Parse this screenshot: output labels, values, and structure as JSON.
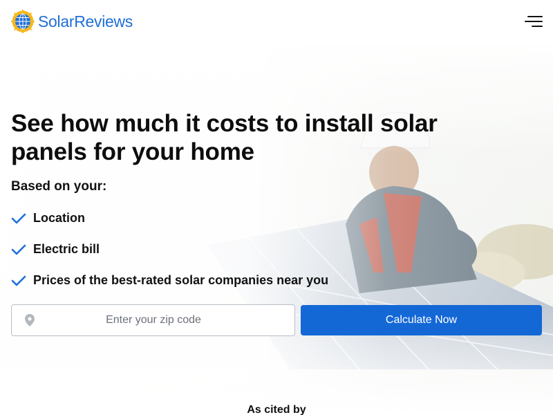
{
  "header": {
    "brand": "SolarReviews",
    "logo_icon": "sun-globe-logo-icon",
    "menu_icon": "hamburger-menu-icon"
  },
  "hero": {
    "headline": "See how much it costs to install solar panels for your home",
    "based_on": "Based on your:",
    "check_icon": "checkmark-icon",
    "items": [
      {
        "label": "Location"
      },
      {
        "label": "Electric bill"
      },
      {
        "label": "Prices of the best-rated solar companies near you"
      }
    ],
    "background": "solar-installer-photo"
  },
  "form": {
    "zip_placeholder": "Enter your zip code",
    "zip_value": "",
    "pin_icon": "location-pin-icon",
    "submit_label": "Calculate Now"
  },
  "footer": {
    "cited_by": "As cited by"
  },
  "colors": {
    "brand_blue": "#1f6fd6",
    "button_blue": "#1468d6",
    "check_blue": "#1a6fd8",
    "logo_sun": "#f5b820"
  }
}
